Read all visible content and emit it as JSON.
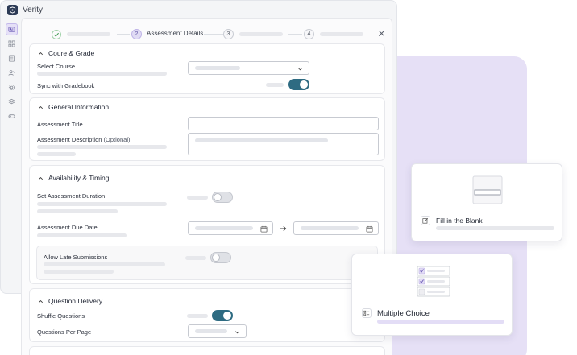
{
  "app": {
    "title": "Verity",
    "logo_icon": "shield-logo-icon"
  },
  "sidebar": {
    "items": [
      {
        "icon": "ai-assistant-icon",
        "active": true
      },
      {
        "icon": "grid-icon",
        "active": false
      },
      {
        "icon": "book-icon",
        "active": false
      },
      {
        "icon": "users-icon",
        "active": false
      },
      {
        "icon": "gear-icon",
        "active": false
      },
      {
        "icon": "layers-icon",
        "active": false
      },
      {
        "icon": "toggle-icon",
        "active": false
      }
    ]
  },
  "stepper": {
    "steps": [
      {
        "status": "completed",
        "icon": "check-icon"
      },
      {
        "number": "2",
        "label": "Assessment Details",
        "status": "active"
      },
      {
        "number": "3",
        "status": "upcoming"
      },
      {
        "number": "4",
        "status": "upcoming"
      }
    ]
  },
  "course_grade": {
    "heading": "Coure & Grade",
    "select_course_label": "Select Course",
    "sync_label": "Sync with Gradebook",
    "sync_on": true
  },
  "general_info": {
    "heading": "General Information",
    "title_label": "Assessment Title",
    "description_label": "Assessment Description",
    "description_optional": "(Optional)"
  },
  "availability": {
    "heading": "Availability & Timing",
    "duration_label": "Set Assessment Duration",
    "duration_on": false,
    "due_date_label": "Assessment Due Date",
    "late_label": "Allow Late Submissions",
    "late_on": false
  },
  "question_delivery": {
    "heading": "Question Delivery",
    "shuffle_label": "Shuffle Questions",
    "shuffle_on": true,
    "per_page_label": "Questions Per Page"
  },
  "cards": {
    "fill_blank": {
      "title": "Fill in the Blank",
      "icon": "edit-square-icon"
    },
    "multiple_choice": {
      "title": "Multiple Choice",
      "icon": "checklist-icon"
    }
  },
  "colors": {
    "accent": "#2e6b82",
    "lavender": "#e6e0f6",
    "step_active": "#e0dbf4"
  }
}
